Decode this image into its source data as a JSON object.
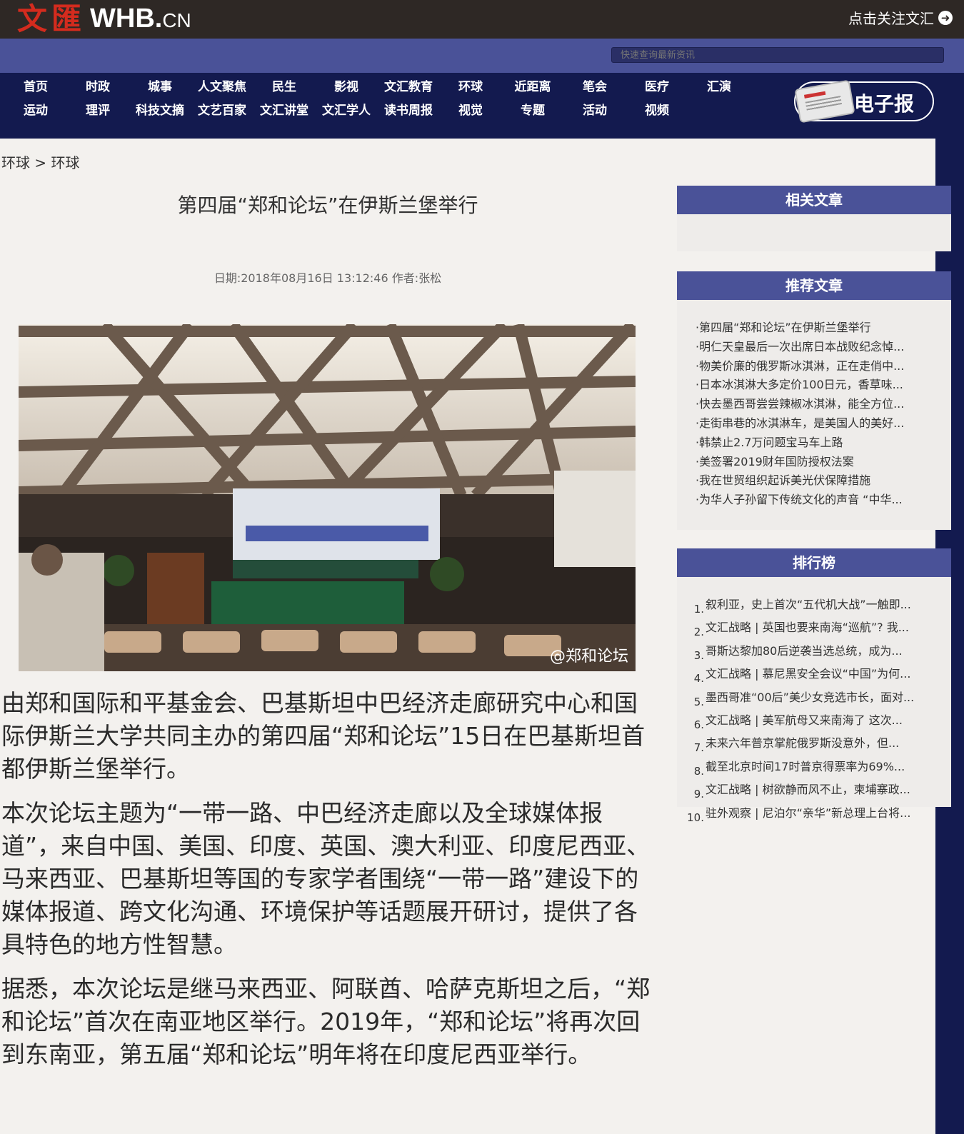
{
  "header": {
    "logo_cn": "文匯",
    "logo_en": "WHB.",
    "logo_domain": "CN",
    "follow_text": "点击关注文汇",
    "follow_icon": "arrow-right-circle-icon"
  },
  "search": {
    "placeholder": "快速查询最新资讯"
  },
  "nav": {
    "row1": [
      "首页",
      "时政",
      "城事",
      "人文聚焦",
      "民生",
      "影视",
      "文汇教育",
      "环球",
      "近距离",
      "笔会",
      "医疗",
      "汇演"
    ],
    "row2": [
      "运动",
      "理评",
      "科技文摘",
      "文艺百家",
      "文汇讲堂",
      "文汇学人",
      "读书周报",
      "视觉",
      "专题",
      "活动",
      "视频"
    ],
    "epaper_label": "电子报"
  },
  "breadcrumb": "环球 > 环球",
  "article": {
    "title": "第四届“郑和论坛”在伊斯兰堡举行",
    "meta": "日期:2018年08月16日 13:12:46 作者:张松",
    "image_watermark": "@郑和论坛",
    "paragraphs": [
      "由郑和国际和平基金会、巴基斯坦中巴经济走廊研究中心和国际伊斯兰大学共同主办的第四届“郑和论坛”15日在巴基斯坦首都伊斯兰堡举行。",
      "本次论坛主题为“一带一路、中巴经济走廊以及全球媒体报道”，来自中国、美国、印度、英国、澳大利亚、印度尼西亚、马来西亚、巴基斯坦等国的专家学者围绕“一带一路”建设下的媒体报道、跨文化沟通、环境保护等话题展开研讨，提供了各具特色的地方性智慧。",
      "据悉，本次论坛是继马来西亚、阿联酋、哈萨克斯坦之后，“郑和论坛”首次在南亚地区举行。2019年，“郑和论坛”将再次回到东南亚，第五届“郑和论坛”明年将在印度尼西亚举行。"
    ]
  },
  "sidebar": {
    "related_title": "相关文章",
    "recommended_title": "推荐文章",
    "recommended": [
      "·第四届“郑和论坛”在伊斯兰堡举行",
      "·明仁天皇最后一次出席日本战败纪念悼...",
      "·物美价廉的俄罗斯冰淇淋，正在走俏中...",
      "·日本冰淇淋大多定价100日元，香草味...",
      "·快去墨西哥尝尝辣椒冰淇淋，能全方位...",
      "·走街串巷的冰淇淋车，是美国人的美好...",
      "·韩禁止2.7万问题宝马车上路",
      "·美签署2019财年国防授权法案",
      "·我在世贸组织起诉美光伏保障措施",
      "·为华人子孙留下传统文化的声音 “中华..."
    ],
    "ranking_title": "排行榜",
    "ranking": [
      "叙利亚，史上首次“五代机大战”一触即...",
      "文汇战略 | 英国也要来南海“巡航”? 我...",
      "哥斯达黎加80后逆袭当选总统，成为...",
      "文汇战略 | 慕尼黑安全会议“中国”为何...",
      "墨西哥准“00后”美少女竞选市长，面对...",
      "文汇战略 | 美军航母又来南海了 这次...",
      "未来六年普京掌舵俄罗斯没意外，但...",
      "截至北京时间17时普京得票率为69%...",
      "文汇战略 | 树欲静而风不止，柬埔寨政...",
      "驻外观察 | 尼泊尔“亲华”新总理上台将..."
    ]
  }
}
